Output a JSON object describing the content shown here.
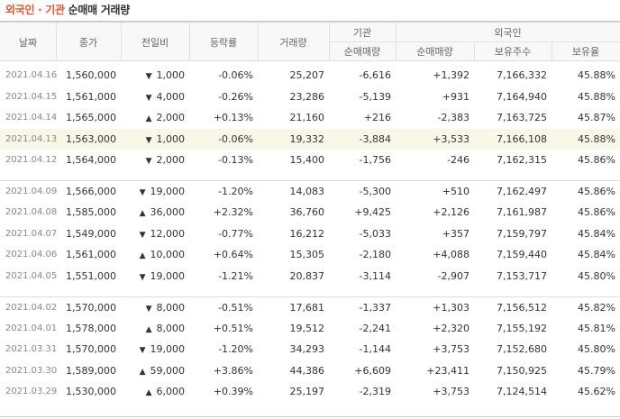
{
  "title": {
    "highlight": "외국인 · 기관",
    "rest": "순매매 거래량"
  },
  "headers": {
    "date": "날짜",
    "close": "종가",
    "change": "전일비",
    "rate": "등락률",
    "volume": "거래량",
    "inst_group": "기관",
    "inst_net": "순매매량",
    "foreign_group": "외국인",
    "foreign_net": "순매매량",
    "foreign_shares": "보유주수",
    "foreign_ratio": "보유율"
  },
  "groups": [
    [
      {
        "date": "2021.04.16",
        "close": "1,560,000",
        "dir": "down",
        "change": "1,000",
        "rate": "-0.06%",
        "volume": "25,207",
        "inst": "-6,616",
        "foreign": "+1,392",
        "shares": "7,166,332",
        "ratio": "45.88%"
      },
      {
        "date": "2021.04.15",
        "close": "1,561,000",
        "dir": "down",
        "change": "4,000",
        "rate": "-0.26%",
        "volume": "23,286",
        "inst": "-5,139",
        "foreign": "+931",
        "shares": "7,164,940",
        "ratio": "45.88%"
      },
      {
        "date": "2021.04.14",
        "close": "1,565,000",
        "dir": "up",
        "change": "2,000",
        "rate": "+0.13%",
        "volume": "21,160",
        "inst": "+216",
        "foreign": "-2,383",
        "shares": "7,163,725",
        "ratio": "45.87%"
      },
      {
        "date": "2021.04.13",
        "close": "1,563,000",
        "dir": "down",
        "change": "1,000",
        "rate": "-0.06%",
        "volume": "19,332",
        "inst": "-3,884",
        "foreign": "+3,533",
        "shares": "7,166,108",
        "ratio": "45.88%",
        "highlight": true
      },
      {
        "date": "2021.04.12",
        "close": "1,564,000",
        "dir": "down",
        "change": "2,000",
        "rate": "-0.13%",
        "volume": "15,400",
        "inst": "-1,756",
        "foreign": "-246",
        "shares": "7,162,315",
        "ratio": "45.86%"
      }
    ],
    [
      {
        "date": "2021.04.09",
        "close": "1,566,000",
        "dir": "down",
        "change": "19,000",
        "rate": "-1.20%",
        "volume": "14,083",
        "inst": "-5,300",
        "foreign": "+510",
        "shares": "7,162,497",
        "ratio": "45.86%"
      },
      {
        "date": "2021.04.08",
        "close": "1,585,000",
        "dir": "up",
        "change": "36,000",
        "rate": "+2.32%",
        "volume": "36,760",
        "inst": "+9,425",
        "foreign": "+2,126",
        "shares": "7,161,987",
        "ratio": "45.86%"
      },
      {
        "date": "2021.04.07",
        "close": "1,549,000",
        "dir": "down",
        "change": "12,000",
        "rate": "-0.77%",
        "volume": "16,212",
        "inst": "-5,033",
        "foreign": "+357",
        "shares": "7,159,797",
        "ratio": "45.84%"
      },
      {
        "date": "2021.04.06",
        "close": "1,561,000",
        "dir": "up",
        "change": "10,000",
        "rate": "+0.64%",
        "volume": "15,305",
        "inst": "-2,180",
        "foreign": "+4,088",
        "shares": "7,159,440",
        "ratio": "45.84%"
      },
      {
        "date": "2021.04.05",
        "close": "1,551,000",
        "dir": "down",
        "change": "19,000",
        "rate": "-1.21%",
        "volume": "20,837",
        "inst": "-3,114",
        "foreign": "-2,907",
        "shares": "7,153,717",
        "ratio": "45.80%"
      }
    ],
    [
      {
        "date": "2021.04.02",
        "close": "1,570,000",
        "dir": "down",
        "change": "8,000",
        "rate": "-0.51%",
        "volume": "17,681",
        "inst": "-1,337",
        "foreign": "+1,303",
        "shares": "7,156,512",
        "ratio": "45.82%"
      },
      {
        "date": "2021.04.01",
        "close": "1,578,000",
        "dir": "up",
        "change": "8,000",
        "rate": "+0.51%",
        "volume": "19,512",
        "inst": "-2,241",
        "foreign": "+2,320",
        "shares": "7,155,192",
        "ratio": "45.81%"
      },
      {
        "date": "2021.03.31",
        "close": "1,570,000",
        "dir": "down",
        "change": "19,000",
        "rate": "-1.20%",
        "volume": "34,293",
        "inst": "-1,144",
        "foreign": "+3,753",
        "shares": "7,152,680",
        "ratio": "45.80%"
      },
      {
        "date": "2021.03.30",
        "close": "1,589,000",
        "dir": "up",
        "change": "59,000",
        "rate": "+3.86%",
        "volume": "44,386",
        "inst": "+6,609",
        "foreign": "+23,411",
        "shares": "7,150,925",
        "ratio": "45.79%"
      },
      {
        "date": "2021.03.29",
        "close": "1,530,000",
        "dir": "up",
        "change": "6,000",
        "rate": "+0.39%",
        "volume": "25,197",
        "inst": "-2,319",
        "foreign": "+3,753",
        "shares": "7,124,514",
        "ratio": "45.62%"
      }
    ]
  ],
  "colors": {
    "up": "#d7101b",
    "down": "#1053c9",
    "title_accent": "#e5532d",
    "highlight_row": "#f8f7e8"
  },
  "icons": {
    "up": "triangle-up-icon",
    "down": "triangle-down-icon"
  }
}
